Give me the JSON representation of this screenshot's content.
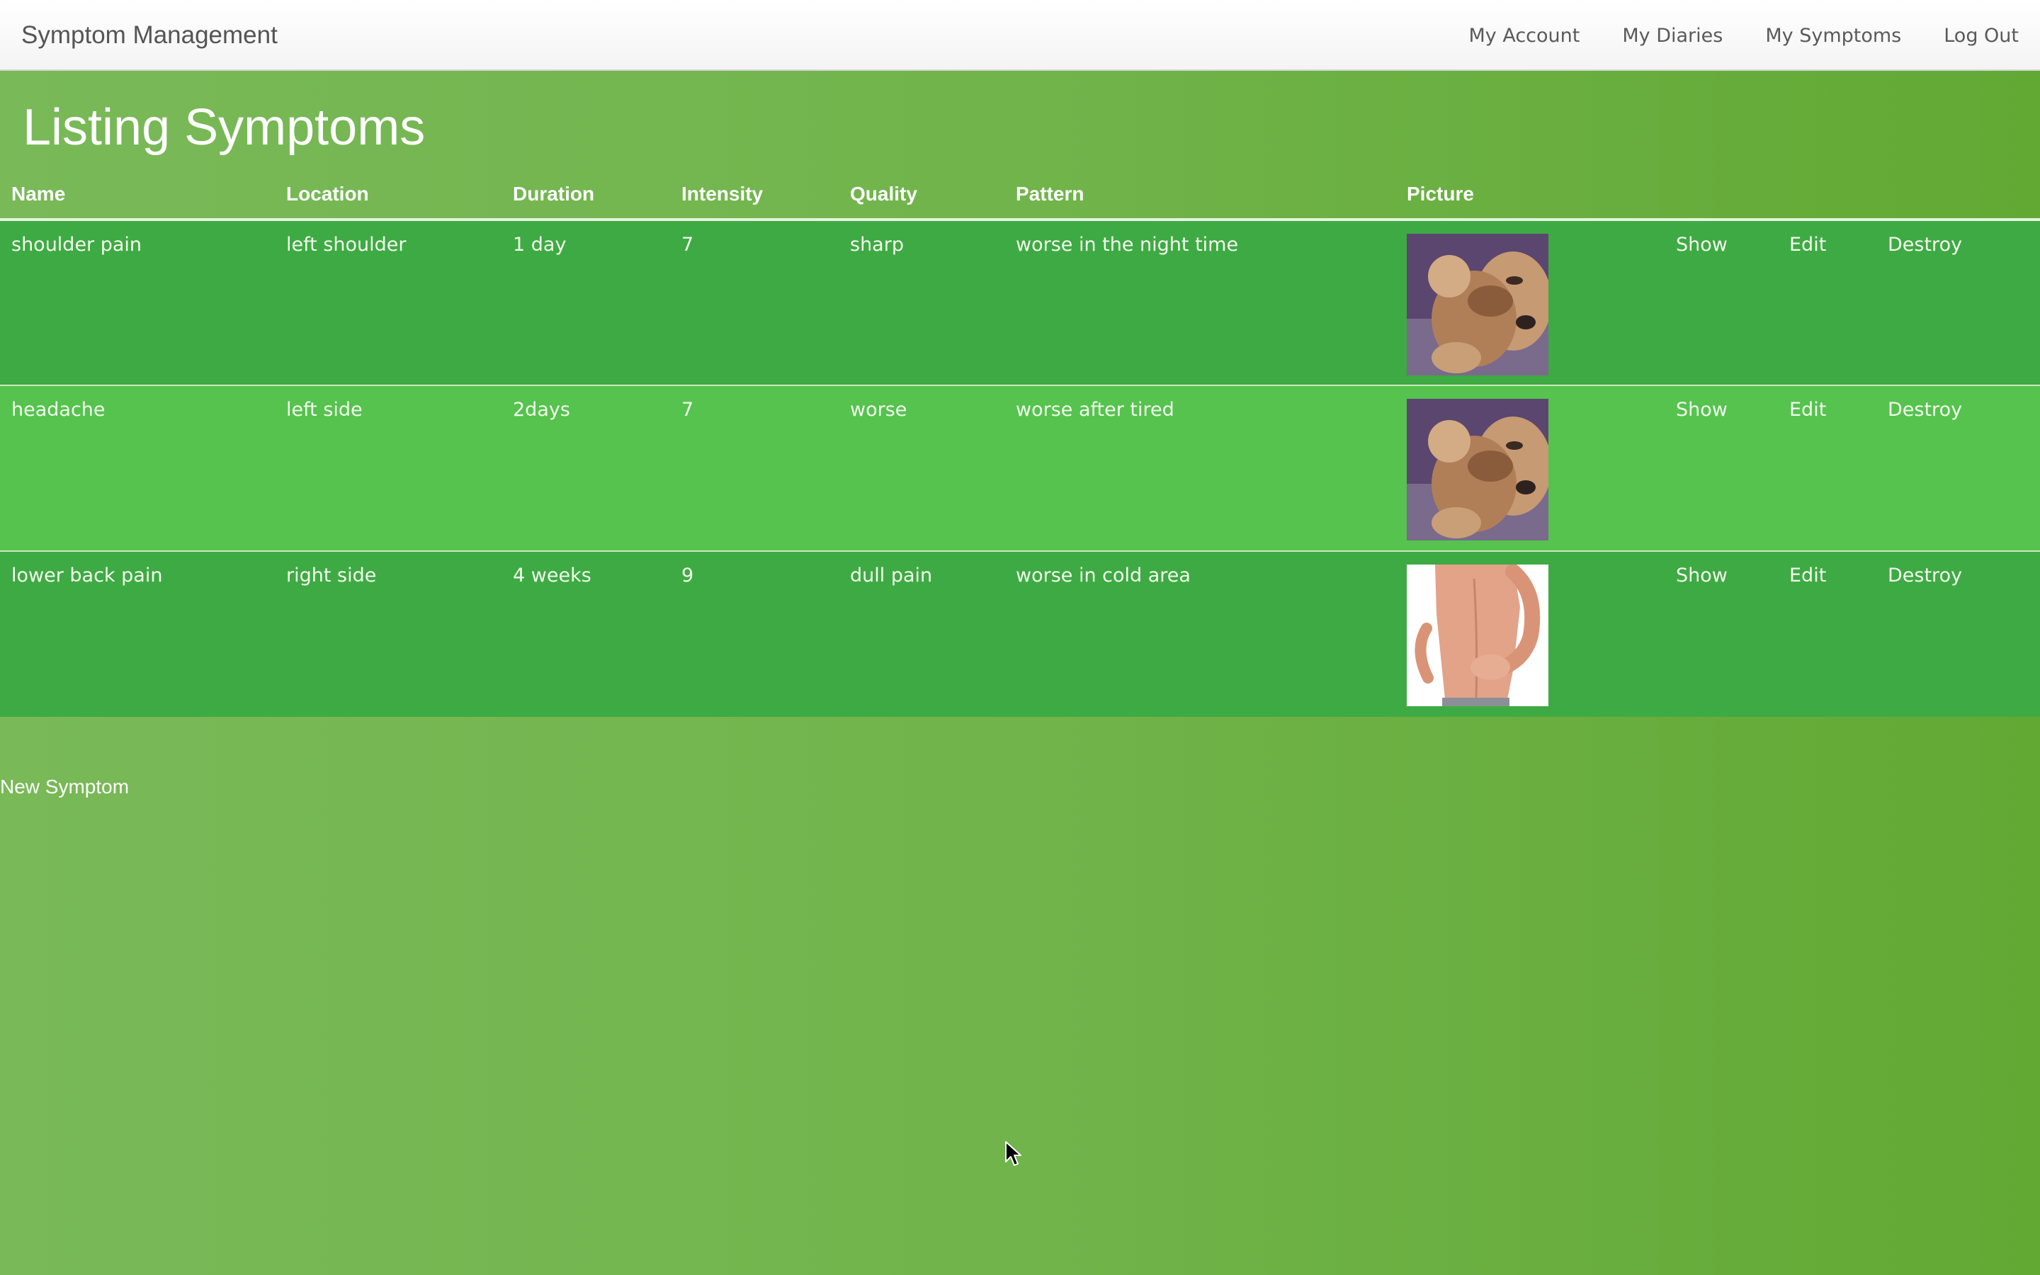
{
  "app": {
    "brand": "Symptom Management"
  },
  "nav": {
    "items": [
      {
        "label": "My Account"
      },
      {
        "label": "My Diaries"
      },
      {
        "label": "My Symptoms"
      },
      {
        "label": "Log Out"
      }
    ]
  },
  "page": {
    "title": "Listing Symptoms"
  },
  "table": {
    "headers": [
      "Name",
      "Location",
      "Duration",
      "Intensity",
      "Quality",
      "Pattern",
      "Picture"
    ],
    "rows": [
      {
        "name": "shoulder pain",
        "location": "left shoulder",
        "duration": "1 day",
        "intensity": "7",
        "quality": "sharp",
        "pattern": "worse in the night time",
        "picture": "puppy-photo",
        "show": "Show",
        "edit": "Edit",
        "destroy": "Destroy"
      },
      {
        "name": "headache",
        "location": "left side",
        "duration": "2days",
        "intensity": "7",
        "quality": "worse",
        "pattern": "worse after tired",
        "picture": "puppy-photo",
        "show": "Show",
        "edit": "Edit",
        "destroy": "Destroy"
      },
      {
        "name": "lower back pain",
        "location": "right side",
        "duration": "4 weeks",
        "intensity": "9",
        "quality": "dull pain",
        "pattern": "worse in cold area",
        "picture": "back-pain-photo",
        "show": "Show",
        "edit": "Edit",
        "destroy": "Destroy"
      }
    ]
  },
  "actions": {
    "new_symptom": "New Symptom"
  },
  "colors": {
    "background_gradient_start": "#79b958",
    "background_gradient_end": "#62a934",
    "row_dark": "#3eaa43",
    "row_light": "#55c34e",
    "navbar": "#f8f8f8"
  },
  "icons": {
    "cursor": "mouse-pointer-icon"
  }
}
